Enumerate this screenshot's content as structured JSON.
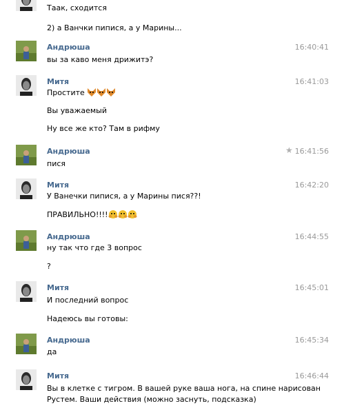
{
  "messages": [
    {
      "author": "",
      "time": "",
      "avatar": "mitya",
      "lines": [
        "Таак, сходится",
        "2) а Ванчки пипися, а у Марины..."
      ]
    },
    {
      "author": "Андрюша",
      "time": "16:40:41",
      "avatar": "andryusha",
      "lines": [
        "вы за каво меня дрижитэ?"
      ]
    },
    {
      "author": "Митя",
      "time": "16:41:03",
      "avatar": "mitya",
      "lines": [
        "Простите",
        "Вы уважаемый",
        "Ну все же кто? Там в рифму"
      ],
      "emoji": [
        "fox-icon",
        "fox-icon",
        "fox-icon"
      ]
    },
    {
      "author": "Андрюша",
      "time": "16:41:56",
      "avatar": "andryusha",
      "lines": [
        "пися"
      ],
      "starred": true
    },
    {
      "author": "Митя",
      "time": "16:42:20",
      "avatar": "mitya",
      "lines": [
        "У Ванечки пипися, а у Марины пися??!",
        "ПРАВИЛЬНО!!!!"
      ],
      "emoji": [
        "clapping-face-icon",
        "clapping-face-icon",
        "clapping-face-icon"
      ]
    },
    {
      "author": "Андрюша",
      "time": "16:44:55",
      "avatar": "andryusha",
      "lines": [
        "ну так что где 3 вопрос",
        "?"
      ]
    },
    {
      "author": "Митя",
      "time": "16:45:01",
      "avatar": "mitya",
      "lines": [
        "И последний вопрос",
        "Надеюсь вы готовы:"
      ]
    },
    {
      "author": "Андрюша",
      "time": "16:45:34",
      "avatar": "andryusha",
      "lines": [
        "да"
      ]
    },
    {
      "author": "Митя",
      "time": "16:46:44",
      "avatar": "mitya",
      "lines": [
        "Вы в клетке с тигром. В вашей руке ваша нога, на спине нарисован",
        "Рустем. Ваши действия (можно заснуть, подсказка)"
      ]
    }
  ],
  "colors": {
    "author": "#45688e",
    "time": "#999999",
    "text": "#000000"
  }
}
